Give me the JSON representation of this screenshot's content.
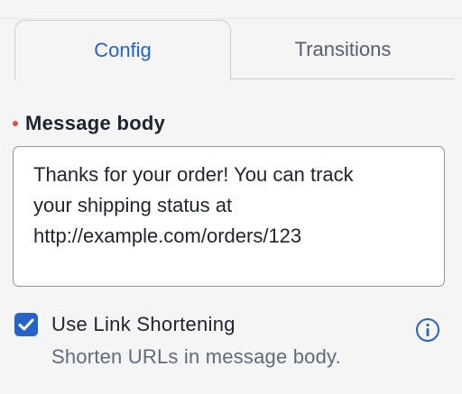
{
  "tabs": [
    {
      "label": "Config",
      "active": true
    },
    {
      "label": "Transitions",
      "active": false
    }
  ],
  "message_body": {
    "label": "Message body",
    "required": true,
    "value": "Thanks for your order! You can track\nyour shipping status at\nhttp://example.com/orders/123"
  },
  "link_shortening": {
    "label": "Use Link Shortening",
    "description": "Shorten URLs in message body.",
    "checked": true,
    "info_icon": "info-icon"
  },
  "colors": {
    "accent": "#2563c9",
    "required_marker": "#e4503f",
    "text_primary": "#1d2430",
    "text_secondary": "#5f6b7a"
  }
}
